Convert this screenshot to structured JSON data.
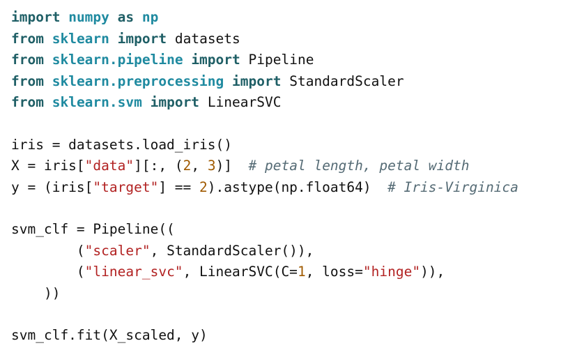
{
  "code": {
    "language": "python",
    "colors": {
      "keyword": "#1f5f66",
      "module": "#1f8aa0",
      "string": "#b22222",
      "number": "#a05a00",
      "comment": "#556b75",
      "text": "#111111"
    },
    "lines": [
      {
        "tokens": [
          {
            "t": "import",
            "k": "kw"
          },
          {
            "t": " ",
            "k": "op"
          },
          {
            "t": "numpy",
            "k": "mod"
          },
          {
            "t": " ",
            "k": "op"
          },
          {
            "t": "as",
            "k": "kw"
          },
          {
            "t": " ",
            "k": "op"
          },
          {
            "t": "np",
            "k": "mod"
          }
        ]
      },
      {
        "tokens": [
          {
            "t": "from",
            "k": "kw"
          },
          {
            "t": " ",
            "k": "op"
          },
          {
            "t": "sklearn",
            "k": "mod"
          },
          {
            "t": " ",
            "k": "op"
          },
          {
            "t": "import",
            "k": "kw"
          },
          {
            "t": " ",
            "k": "op"
          },
          {
            "t": "datasets",
            "k": "id"
          }
        ]
      },
      {
        "tokens": [
          {
            "t": "from",
            "k": "kw"
          },
          {
            "t": " ",
            "k": "op"
          },
          {
            "t": "sklearn.pipeline",
            "k": "mod"
          },
          {
            "t": " ",
            "k": "op"
          },
          {
            "t": "import",
            "k": "kw"
          },
          {
            "t": " ",
            "k": "op"
          },
          {
            "t": "Pipeline",
            "k": "class"
          }
        ]
      },
      {
        "tokens": [
          {
            "t": "from",
            "k": "kw"
          },
          {
            "t": " ",
            "k": "op"
          },
          {
            "t": "sklearn.preprocessing",
            "k": "mod"
          },
          {
            "t": " ",
            "k": "op"
          },
          {
            "t": "import",
            "k": "kw"
          },
          {
            "t": " ",
            "k": "op"
          },
          {
            "t": "StandardScaler",
            "k": "class"
          }
        ]
      },
      {
        "tokens": [
          {
            "t": "from",
            "k": "kw"
          },
          {
            "t": " ",
            "k": "op"
          },
          {
            "t": "sklearn.svm",
            "k": "mod"
          },
          {
            "t": " ",
            "k": "op"
          },
          {
            "t": "import",
            "k": "kw"
          },
          {
            "t": " ",
            "k": "op"
          },
          {
            "t": "LinearSVC",
            "k": "class"
          }
        ]
      },
      {
        "tokens": []
      },
      {
        "tokens": [
          {
            "t": "iris = datasets.load_iris()",
            "k": "id"
          }
        ]
      },
      {
        "tokens": [
          {
            "t": "X = iris[",
            "k": "id"
          },
          {
            "t": "\"data\"",
            "k": "str"
          },
          {
            "t": "][:, (",
            "k": "id"
          },
          {
            "t": "2",
            "k": "num"
          },
          {
            "t": ", ",
            "k": "id"
          },
          {
            "t": "3",
            "k": "num"
          },
          {
            "t": ")]  ",
            "k": "id"
          },
          {
            "t": "# petal length, petal width",
            "k": "cmt"
          }
        ]
      },
      {
        "tokens": [
          {
            "t": "y = (iris[",
            "k": "id"
          },
          {
            "t": "\"target\"",
            "k": "str"
          },
          {
            "t": "] == ",
            "k": "id"
          },
          {
            "t": "2",
            "k": "num"
          },
          {
            "t": ").astype(np.float64)  ",
            "k": "id"
          },
          {
            "t": "# Iris-Virginica",
            "k": "cmt"
          }
        ]
      },
      {
        "tokens": []
      },
      {
        "tokens": [
          {
            "t": "svm_clf = Pipeline((",
            "k": "id"
          }
        ]
      },
      {
        "tokens": [
          {
            "t": "        (",
            "k": "id"
          },
          {
            "t": "\"scaler\"",
            "k": "str"
          },
          {
            "t": ", StandardScaler()),",
            "k": "id"
          }
        ]
      },
      {
        "tokens": [
          {
            "t": "        (",
            "k": "id"
          },
          {
            "t": "\"linear_svc\"",
            "k": "str"
          },
          {
            "t": ", LinearSVC(C=",
            "k": "id"
          },
          {
            "t": "1",
            "k": "num"
          },
          {
            "t": ", loss=",
            "k": "id"
          },
          {
            "t": "\"hinge\"",
            "k": "str"
          },
          {
            "t": ")),",
            "k": "id"
          }
        ]
      },
      {
        "tokens": [
          {
            "t": "    ))",
            "k": "id"
          }
        ]
      },
      {
        "tokens": []
      },
      {
        "tokens": [
          {
            "t": "svm_clf.fit(X_scaled, y)",
            "k": "id"
          }
        ]
      }
    ]
  }
}
